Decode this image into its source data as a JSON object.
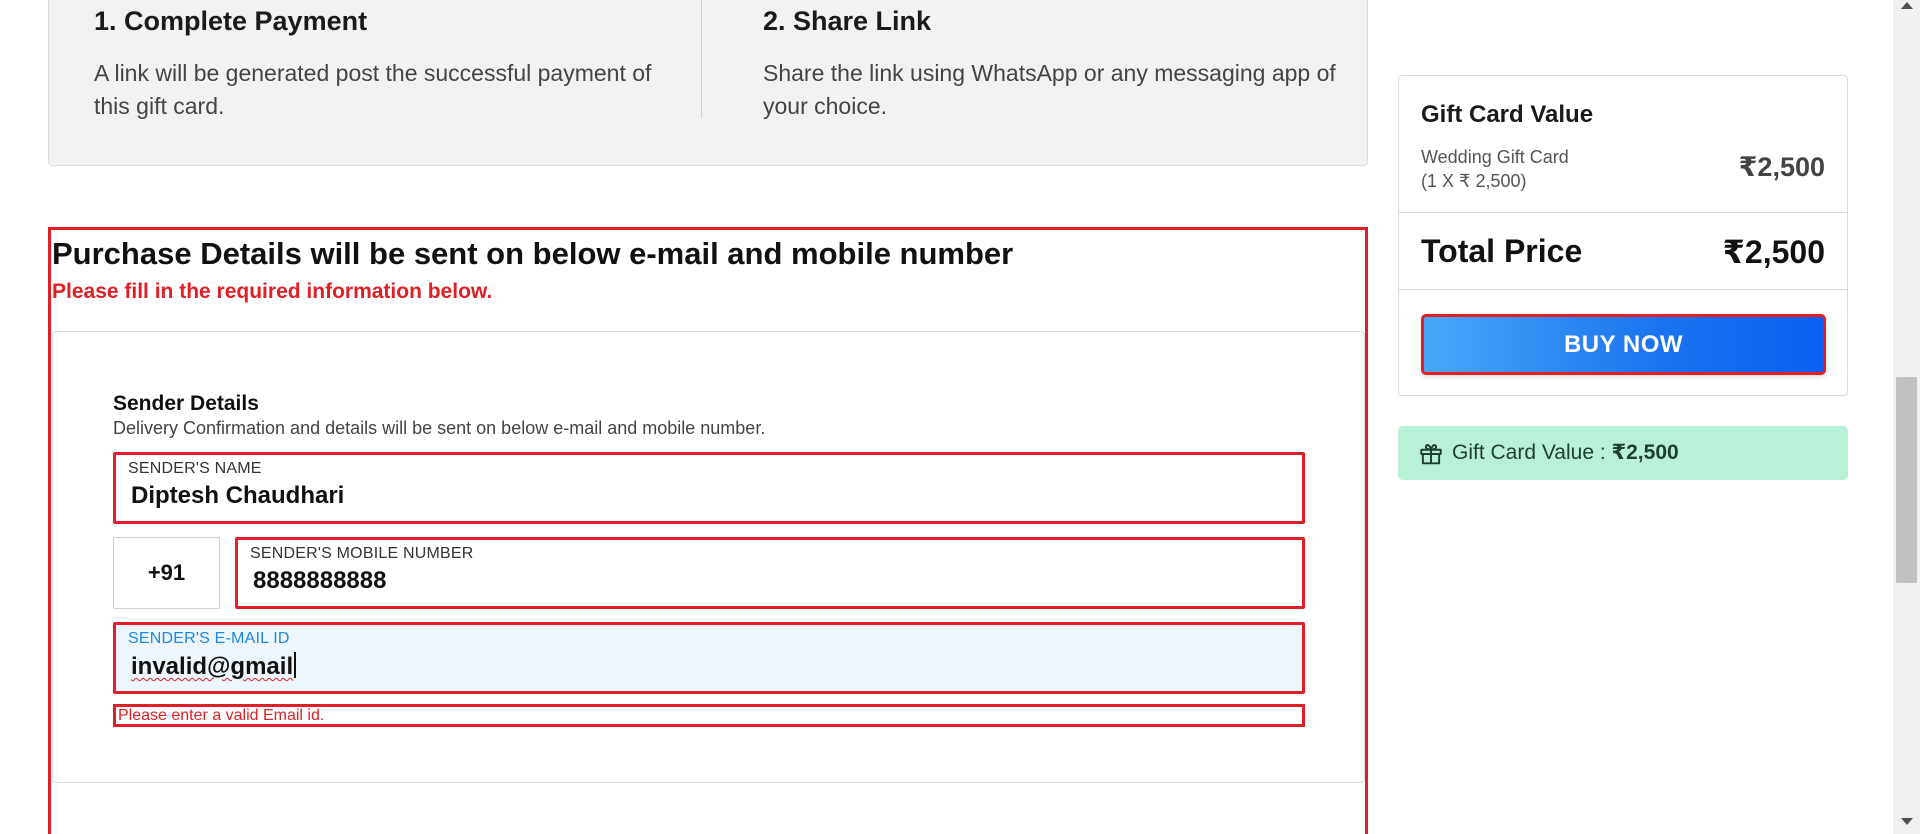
{
  "steps": [
    {
      "title": "1. Complete Payment",
      "text": "A link will be generated post the successful payment of this gift card."
    },
    {
      "title": "2. Share Link",
      "text": "Share the link using WhatsApp or any messaging app of your choice."
    }
  ],
  "purchase": {
    "heading": "Purchase Details will be sent on below e-mail and mobile number",
    "required_msg": "Please fill in the required information below."
  },
  "sender": {
    "title": "Sender Details",
    "subtitle": "Delivery Confirmation and details will be sent on below e-mail and mobile number.",
    "name_label": "SENDER'S NAME",
    "name_value": "Diptesh Chaudhari",
    "country_code": "+91",
    "mobile_label": "SENDER'S MOBILE NUMBER",
    "mobile_value": "8888888888",
    "email_label": "SENDER'S E-MAIL ID",
    "email_value": "invalid@gmail",
    "email_error": "Please enter a valid Email id."
  },
  "summary": {
    "title": "Gift Card Value",
    "item_name": "Wedding Gift Card",
    "item_qty": "(1 X ₹ 2,500)",
    "item_price": "₹2,500",
    "total_label": "Total Price",
    "total_price": "₹2,500",
    "buy_label": "BUY NOW"
  },
  "banner": {
    "label": "Gift Card Value : ",
    "value": "₹2,500",
    "icon": "gift-icon"
  },
  "colors": {
    "error_red": "#e01f26",
    "button_blue": "#1b72f0",
    "banner_green": "#b8f0d8",
    "field_focus_bg": "#eef6fd"
  }
}
